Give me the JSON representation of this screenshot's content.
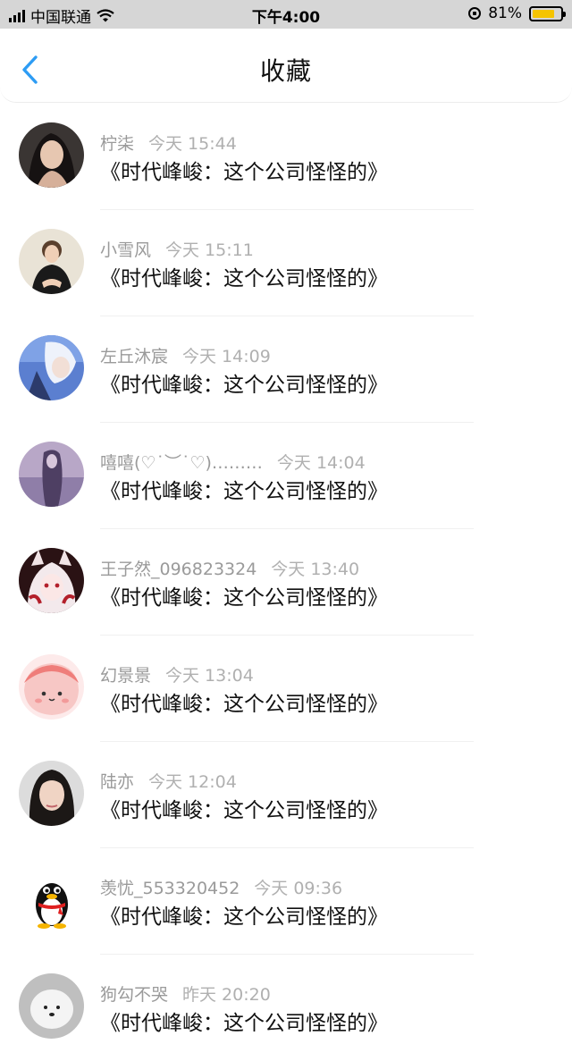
{
  "status_bar": {
    "carrier": "中国联通",
    "time": "下午4:00",
    "battery_percent": "81%",
    "battery_level": 0.81,
    "battery_color": "#f5c400"
  },
  "nav": {
    "back_icon": "chevron-left-icon",
    "title": "收藏",
    "accent": "#2d9cf4"
  },
  "items": [
    {
      "name": "柠柒",
      "time": "今天 15:44",
      "text": "《时代峰峻：这个公司怪怪的》"
    },
    {
      "name": "小雪风",
      "time": "今天 15:11",
      "text": "《时代峰峻：这个公司怪怪的》"
    },
    {
      "name": "左丘沐宸",
      "time": "今天 14:09",
      "text": "《时代峰峻：这个公司怪怪的》"
    },
    {
      "name": "嘻嘻(♡˙︶˙♡)………",
      "time": "今天 14:04",
      "text": "《时代峰峻：这个公司怪怪的》"
    },
    {
      "name": "王子然_096823324",
      "time": "今天 13:40",
      "text": "《时代峰峻：这个公司怪怪的》"
    },
    {
      "name": "幻景景",
      "time": "今天 13:04",
      "text": "《时代峰峻：这个公司怪怪的》"
    },
    {
      "name": "陆亦",
      "time": "今天 12:04",
      "text": "《时代峰峻：这个公司怪怪的》"
    },
    {
      "name": "羡忧_553320452",
      "time": "今天 09:36",
      "text": "《时代峰峻：这个公司怪怪的》"
    },
    {
      "name": "狗勾不哭",
      "time": "昨天 20:20",
      "text": "《时代峰峻：这个公司怪怪的》"
    }
  ]
}
